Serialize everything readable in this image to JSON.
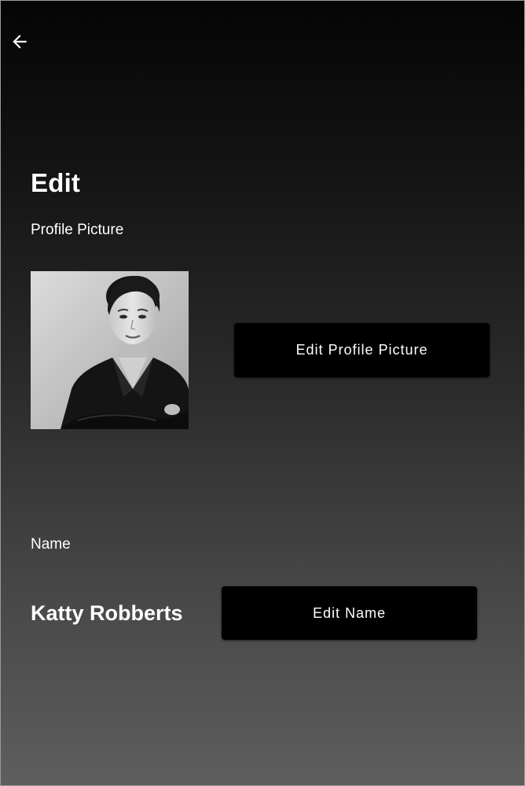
{
  "header": {
    "back_icon": "arrow-left-icon"
  },
  "page": {
    "title": "Edit"
  },
  "profile_picture": {
    "label": "Profile Picture",
    "avatar_description": "portrait-photo",
    "edit_button_label": "Edit Profile Picture"
  },
  "name_section": {
    "label": "Name",
    "value": "Katty Robberts",
    "edit_button_label": "Edit Name"
  },
  "colors": {
    "button_bg": "#000000",
    "text": "#ffffff",
    "gradient_top": "#050505",
    "gradient_bottom": "#5e5e5e"
  }
}
